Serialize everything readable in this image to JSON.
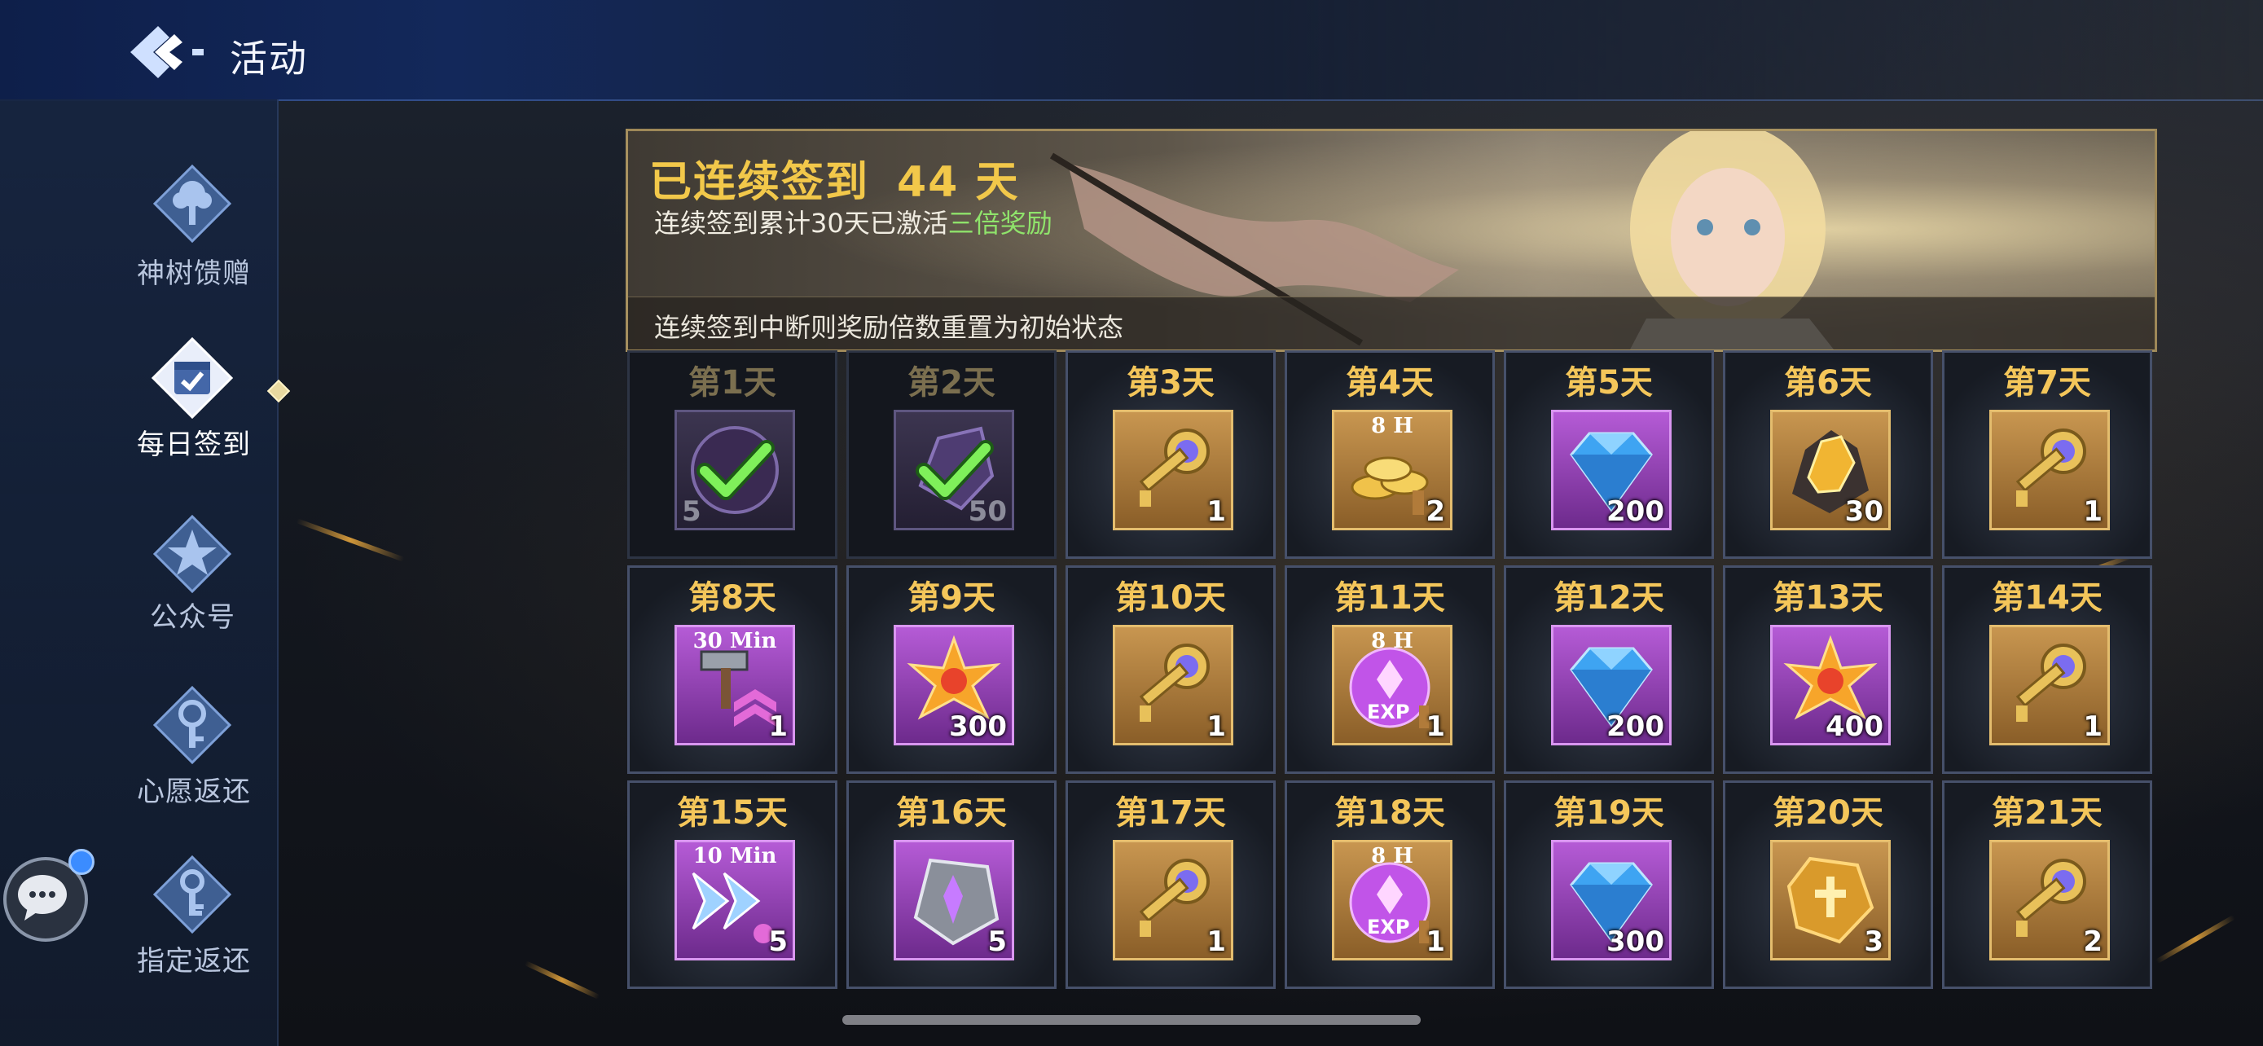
{
  "header": {
    "title": "活动",
    "back_icon": "back-arrow-icon"
  },
  "sidebar": {
    "items": [
      {
        "label": "神树馈赠",
        "icon": "tree-icon",
        "active": false
      },
      {
        "label": "每日签到",
        "icon": "calendar-check-icon",
        "active": true
      },
      {
        "label": "公众号",
        "icon": "star-badge-icon",
        "active": false
      },
      {
        "label": "心愿返还",
        "icon": "wish-key-icon",
        "active": false
      },
      {
        "label": "指定返还",
        "icon": "designated-key-icon",
        "active": false
      }
    ]
  },
  "banner": {
    "title": "已连续签到",
    "days": "44 天",
    "subtitle_prefix": "连续签到累计30天已激活",
    "subtitle_highlight": "三倍奖励",
    "note": "连续签到中断则奖励倍数重置为初始状态"
  },
  "rewards": [
    {
      "day": "第1天",
      "qty": "5",
      "item": "purple-orb",
      "claimed": true
    },
    {
      "day": "第2天",
      "qty": "50",
      "item": "purple-crystal",
      "claimed": true
    },
    {
      "day": "第3天",
      "qty": "1",
      "item": "golden-key",
      "claimed": false
    },
    {
      "day": "第4天",
      "qty": "2",
      "item": "gold-coins",
      "timer": "8 H",
      "claimed": false
    },
    {
      "day": "第5天",
      "qty": "200",
      "item": "blue-diamond",
      "claimed": false
    },
    {
      "day": "第6天",
      "qty": "30",
      "item": "gold-ore",
      "claimed": false
    },
    {
      "day": "第7天",
      "qty": "1",
      "item": "golden-key",
      "claimed": false
    },
    {
      "day": "第8天",
      "qty": "1",
      "item": "hammer-upgrade",
      "timer": "30 Min",
      "claimed": false
    },
    {
      "day": "第9天",
      "qty": "300",
      "item": "star-shard",
      "claimed": false
    },
    {
      "day": "第10天",
      "qty": "1",
      "item": "golden-key",
      "claimed": false
    },
    {
      "day": "第11天",
      "qty": "1",
      "item": "exp-orb",
      "timer": "8 H",
      "claimed": false
    },
    {
      "day": "第12天",
      "qty": "200",
      "item": "blue-diamond",
      "claimed": false
    },
    {
      "day": "第13天",
      "qty": "400",
      "item": "star-shard",
      "claimed": false
    },
    {
      "day": "第14天",
      "qty": "1",
      "item": "golden-key",
      "claimed": false
    },
    {
      "day": "第15天",
      "qty": "5",
      "item": "speed-up",
      "timer": "10 Min",
      "claimed": false
    },
    {
      "day": "第16天",
      "qty": "5",
      "item": "rune-stone",
      "claimed": false
    },
    {
      "day": "第17天",
      "qty": "1",
      "item": "golden-key",
      "claimed": false
    },
    {
      "day": "第18天",
      "qty": "1",
      "item": "exp-orb",
      "timer": "8 H",
      "claimed": false
    },
    {
      "day": "第19天",
      "qty": "300",
      "item": "blue-diamond",
      "claimed": false
    },
    {
      "day": "第20天",
      "qty": "3",
      "item": "gold-rune",
      "claimed": false
    },
    {
      "day": "第21天",
      "qty": "2",
      "item": "golden-key",
      "claimed": false
    }
  ],
  "colors": {
    "accent_gold": "#f4c65a",
    "highlight_green": "#8fe36b",
    "purple_frame": "#b55bd6",
    "gold_frame": "#c89650"
  }
}
